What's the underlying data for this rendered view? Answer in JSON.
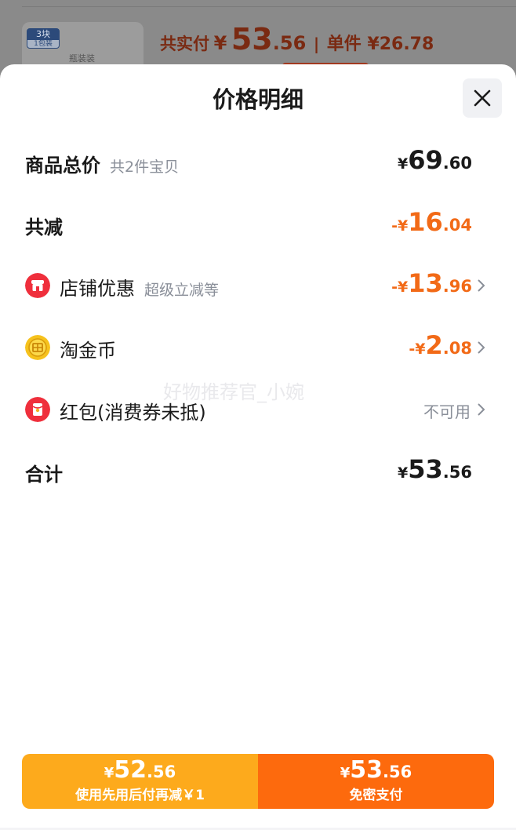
{
  "background": {
    "badge_top": "3块",
    "badge_bottom": "1包装",
    "pack_text": "瓶装装",
    "total_label": "共实付",
    "total_symbol": "¥",
    "total_int": "53",
    "total_dec": ".56",
    "separator": "|",
    "unit_price": "单件 ¥26.78"
  },
  "sheet": {
    "title": "价格明细",
    "close_icon": "close-icon",
    "watermark": "好物推荐官_小婉",
    "rows": {
      "goods_total": {
        "label": "商品总价",
        "sub": "共2件宝贝",
        "symbol": "¥",
        "int": "69",
        "dec": ".60"
      },
      "total_reduce": {
        "label": "共减",
        "symbol": "-¥",
        "int": "16",
        "dec": ".04"
      },
      "shop_discount": {
        "icon": "shop-icon",
        "label": "店铺优惠",
        "sub": "超级立减等",
        "symbol": "-¥",
        "int": "13",
        "dec": ".96"
      },
      "gold_coin": {
        "icon": "gold-coin-icon",
        "label": "淘金币",
        "symbol": "-¥",
        "int": "2",
        "dec": ".08"
      },
      "red_packet": {
        "icon": "red-packet-icon",
        "label": "红包(消费券未抵)",
        "status": "不可用"
      },
      "sum": {
        "label": "合计",
        "symbol": "¥",
        "int": "53",
        "dec": ".56"
      }
    }
  },
  "pay_bar": {
    "left": {
      "symbol": "¥",
      "int": "52",
      "dec": ".56",
      "label": "使用先用后付再减￥1"
    },
    "right": {
      "symbol": "¥",
      "int": "53",
      "dec": ".56",
      "label": "免密支付"
    }
  },
  "colors": {
    "accent_orange": "#f26a17",
    "pay_left": "#fdaa1c",
    "pay_right": "#fd6a0d"
  }
}
